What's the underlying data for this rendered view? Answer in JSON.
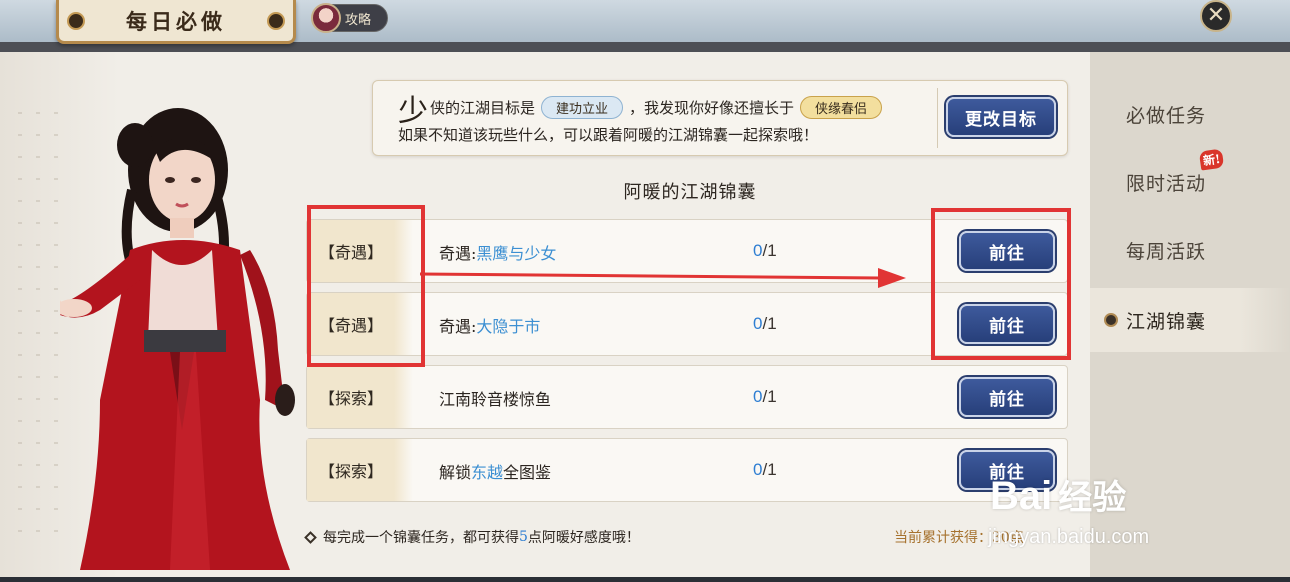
{
  "header": {
    "title": "每日必做",
    "guide_label": "攻略",
    "close_symbol": "✕"
  },
  "goal": {
    "big_char": "少",
    "line1_prefix": "侠的江湖目标是",
    "goal_tag": "建功立业",
    "line1_middle": "，我发现你好像还擅长于",
    "skill_tag": "侠缘春侣",
    "line2": "如果不知道该玩些什么，可以跟着阿暖的江湖锦囊一起探索哦！",
    "change_button": "更改目标"
  },
  "section_title": "阿暖的江湖锦囊",
  "tasks": [
    {
      "category": "【奇遇】",
      "name_prefix": "奇遇:",
      "name_highlight": "黑鹰与少女",
      "name_suffix": "",
      "done": "0",
      "total": "/1",
      "go": "前往"
    },
    {
      "category": "【奇遇】",
      "name_prefix": "奇遇:",
      "name_highlight": "大隐于市",
      "name_suffix": "",
      "done": "0",
      "total": "/1",
      "go": "前往"
    },
    {
      "category": "【探索】",
      "name_prefix": "江南聆音楼惊鱼",
      "name_highlight": "",
      "name_suffix": "",
      "done": "0",
      "total": "/1",
      "go": "前往"
    },
    {
      "category": "【探索】",
      "name_prefix": "解锁",
      "name_highlight": "东越",
      "name_suffix": "全图鉴",
      "done": "0",
      "total": "/1",
      "go": "前往"
    }
  ],
  "footer": {
    "note_prefix": "每完成一个锦囊任务，都可获得",
    "note_number": "5",
    "note_suffix": "点阿暖好感度哦！",
    "accumulated": "当前累计获得：30点"
  },
  "sidebar": {
    "items": [
      {
        "label": "必做任务"
      },
      {
        "label": "限时活动"
      },
      {
        "label": "每周活跃"
      },
      {
        "label": "江湖锦囊"
      }
    ],
    "new_badge": "新!"
  },
  "watermark": {
    "logo": "Bai",
    "logo_cn": "经验",
    "url": "jingyan.baidu.com"
  },
  "colors": {
    "accent_blue": "#2e7ed2",
    "button_blue": "#2f4a8a",
    "annotation_red": "#e13434",
    "gold": "#a6722e"
  }
}
